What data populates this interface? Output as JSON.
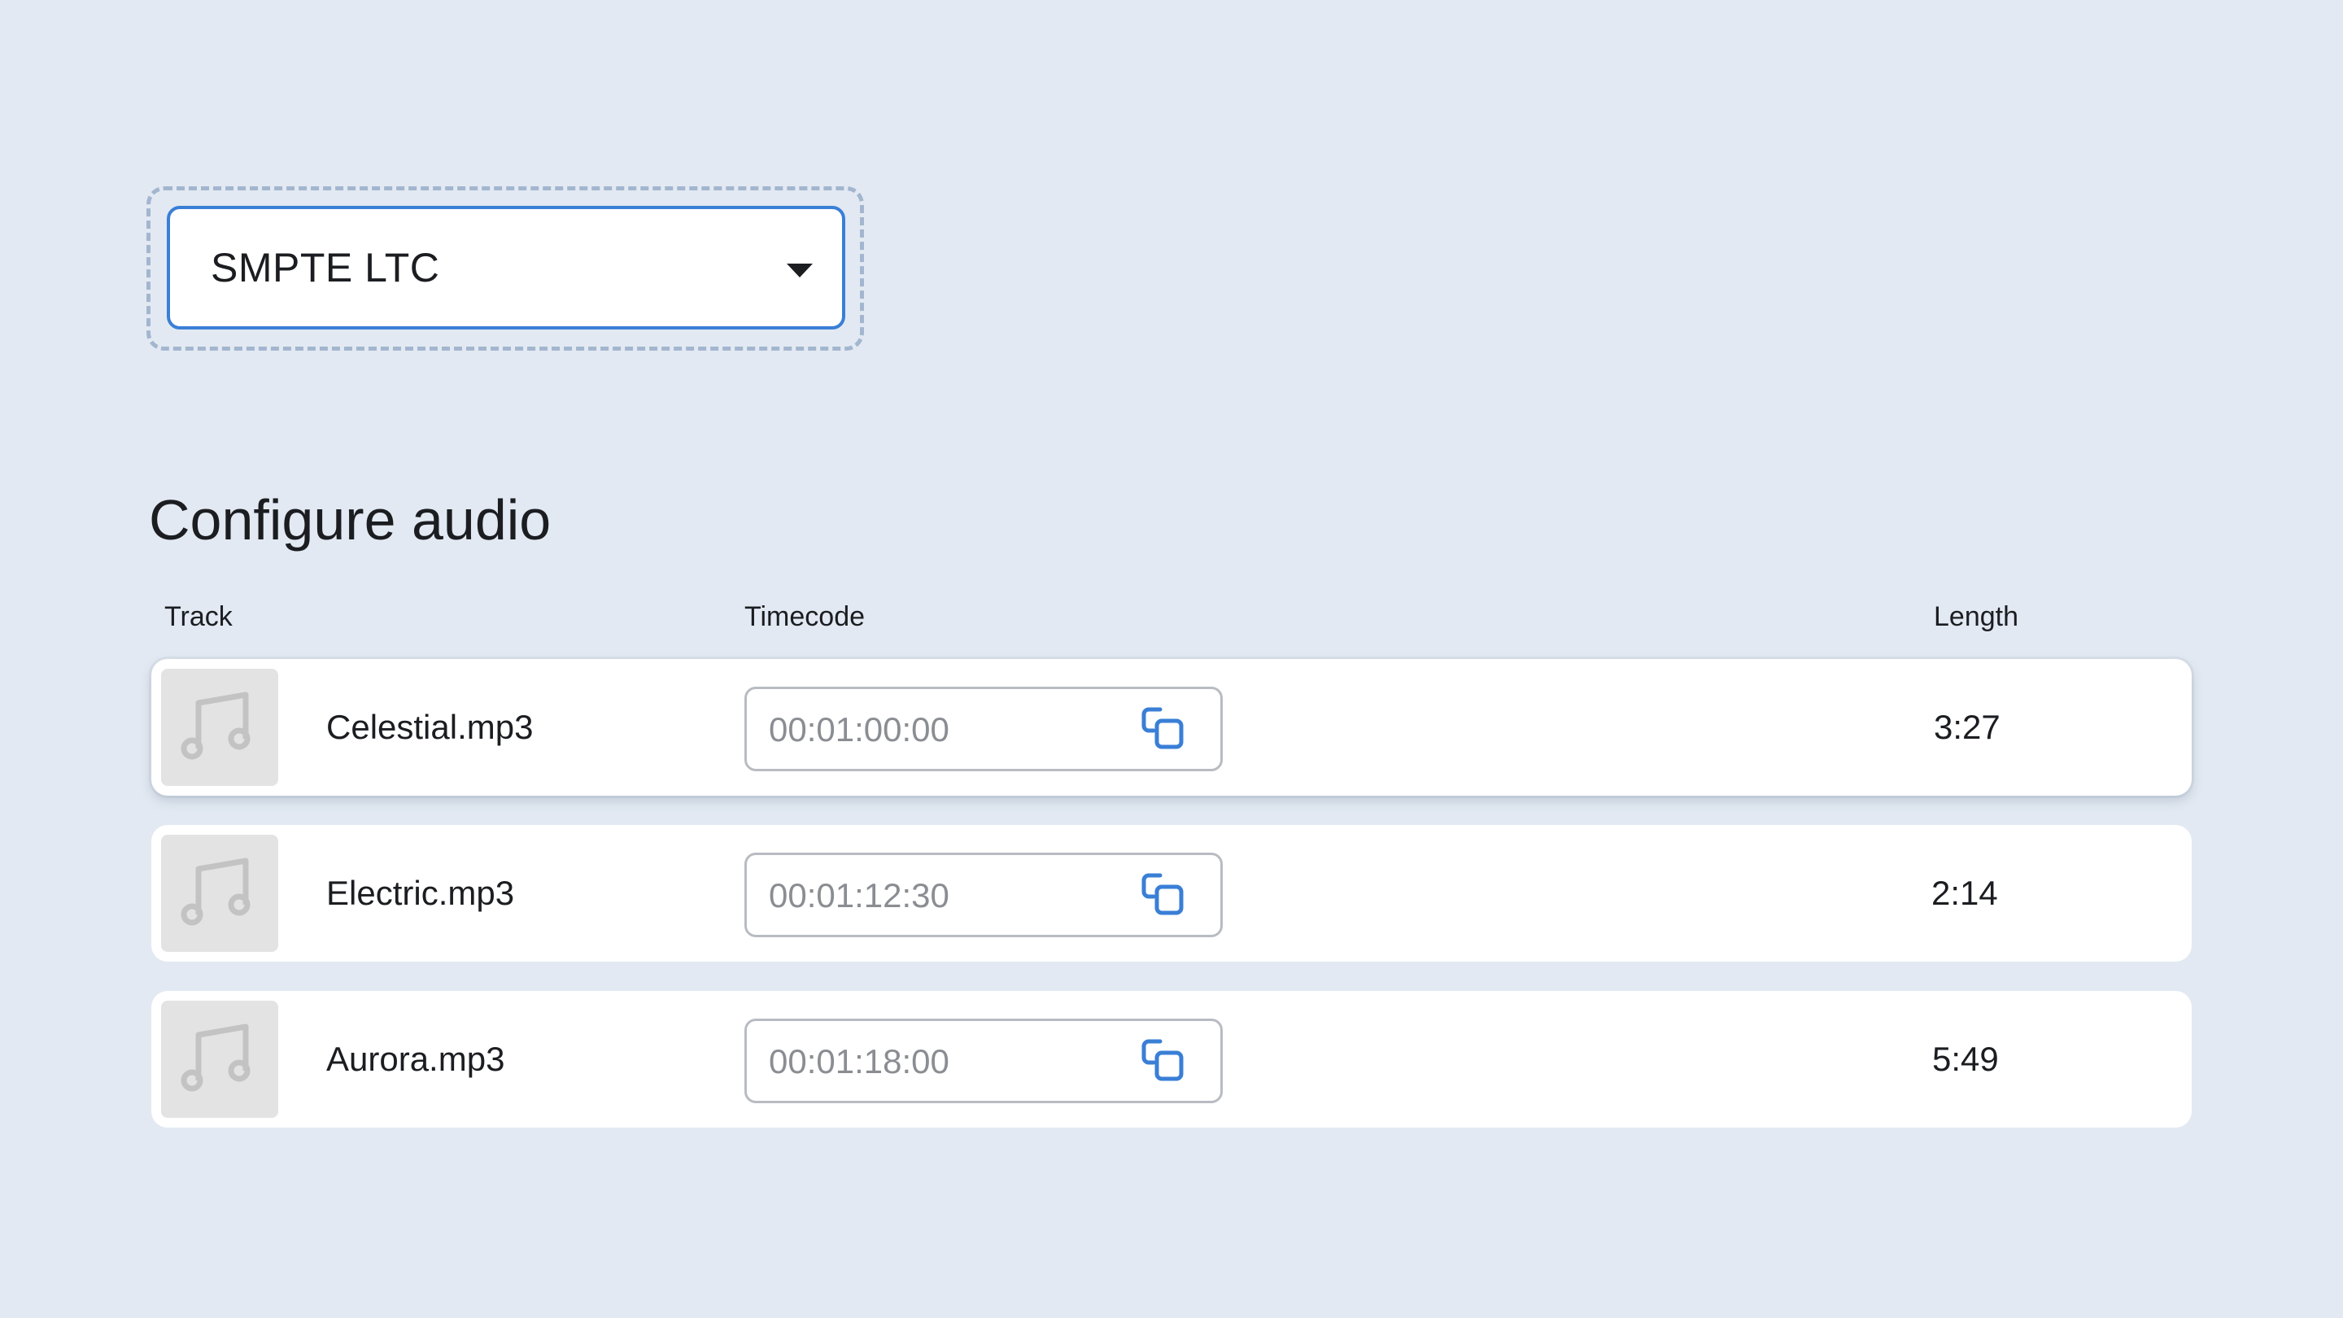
{
  "timecode_format": {
    "selected": "SMPTE LTC",
    "caret_icon": "caret-down-icon"
  },
  "section": {
    "title": "Configure audio"
  },
  "table": {
    "columns": [
      "Track",
      "Timecode",
      "Length"
    ],
    "rows": [
      {
        "track": "Celestial.mp3",
        "timecode": "00:01:00:00",
        "length": "3:27"
      },
      {
        "track": "Electric.mp3",
        "timecode": "00:01:12:30",
        "length": "2:14"
      },
      {
        "track": "Aurora.mp3",
        "timecode": "00:01:18:00",
        "length": "5:49"
      }
    ]
  },
  "icons": {
    "thumbnail": "music-note-icon",
    "copy": "copy-icon"
  },
  "colors": {
    "background": "#e2e9f2",
    "accent": "#3a7fd6",
    "focus_outline": "#a3b6cf",
    "thumbnail_bg": "#e3e3e3",
    "placeholder_text": "#8a8d92"
  }
}
